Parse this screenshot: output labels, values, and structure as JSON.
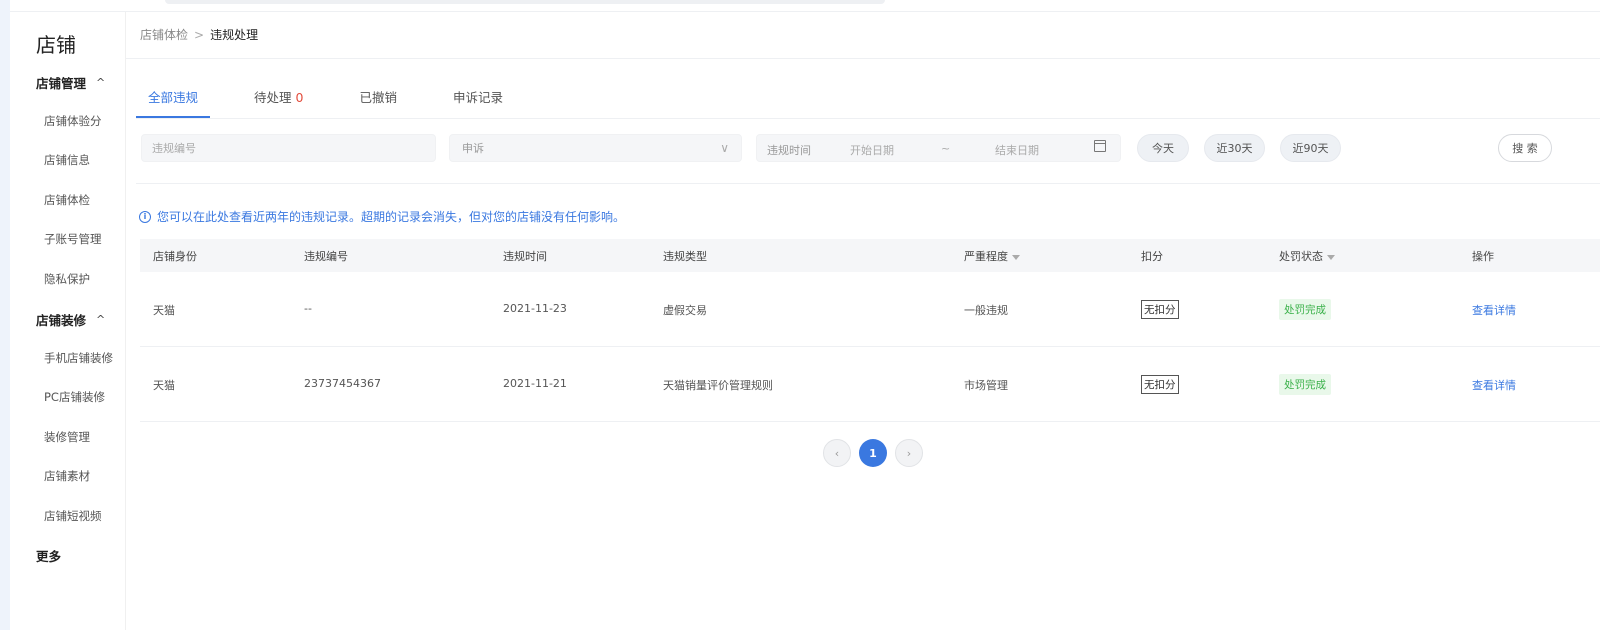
{
  "sidebar": {
    "title": "店铺",
    "groups": [
      {
        "label": "店铺管理",
        "items": [
          "店铺体验分",
          "店铺信息",
          "店铺体检",
          "子账号管理",
          "隐私保护"
        ]
      },
      {
        "label": "店铺装修",
        "items": [
          "手机店铺装修",
          "PC店铺装修",
          "装修管理",
          "店铺素材",
          "店铺短视频"
        ]
      }
    ],
    "more": "更多"
  },
  "breadcrumb": {
    "parent": "店铺体检",
    "separator": ">",
    "current": "违规处理"
  },
  "tabs": [
    {
      "label": "全部违规",
      "active": true
    },
    {
      "label": "待处理",
      "count": "0"
    },
    {
      "label": "已撤销"
    },
    {
      "label": "申诉记录"
    }
  ],
  "filters": {
    "violation_no_placeholder": "违规编号",
    "appeal_select_value": "申诉",
    "time_label": "违规时间",
    "start_placeholder": "开始日期",
    "range_sep": "~",
    "end_placeholder": "结束日期",
    "quick": [
      "今天",
      "近30天",
      "近90天"
    ],
    "search_label": "搜 索"
  },
  "notice": "您可以在此处查看近两年的违规记录。超期的记录会消失，但对您的店铺没有任何影响。",
  "table": {
    "headers": {
      "identity": "店铺身份",
      "number": "违规编号",
      "time": "违规时间",
      "type": "违规类型",
      "severity": "严重程度",
      "deduction": "扣分",
      "status": "处罚状态",
      "action": "操作"
    },
    "rows": [
      {
        "identity": "天猫",
        "number": "--",
        "time": "2021-11-23",
        "type": "虚假交易",
        "severity": "一般违规",
        "deduction": "无扣分",
        "status": "处罚完成",
        "action": "查看详情"
      },
      {
        "identity": "天猫",
        "number": "23737454367",
        "time": "2021-11-21",
        "type": "天猫销量评价管理规则",
        "severity": "市场管理",
        "deduction": "无扣分",
        "status": "处罚完成",
        "action": "查看详情"
      }
    ]
  },
  "pagination": {
    "prev": "‹",
    "current": "1",
    "next": "›"
  },
  "colors": {
    "accent": "#3a78e0",
    "success": "#3bb14a",
    "danger": "#e34d3d"
  }
}
